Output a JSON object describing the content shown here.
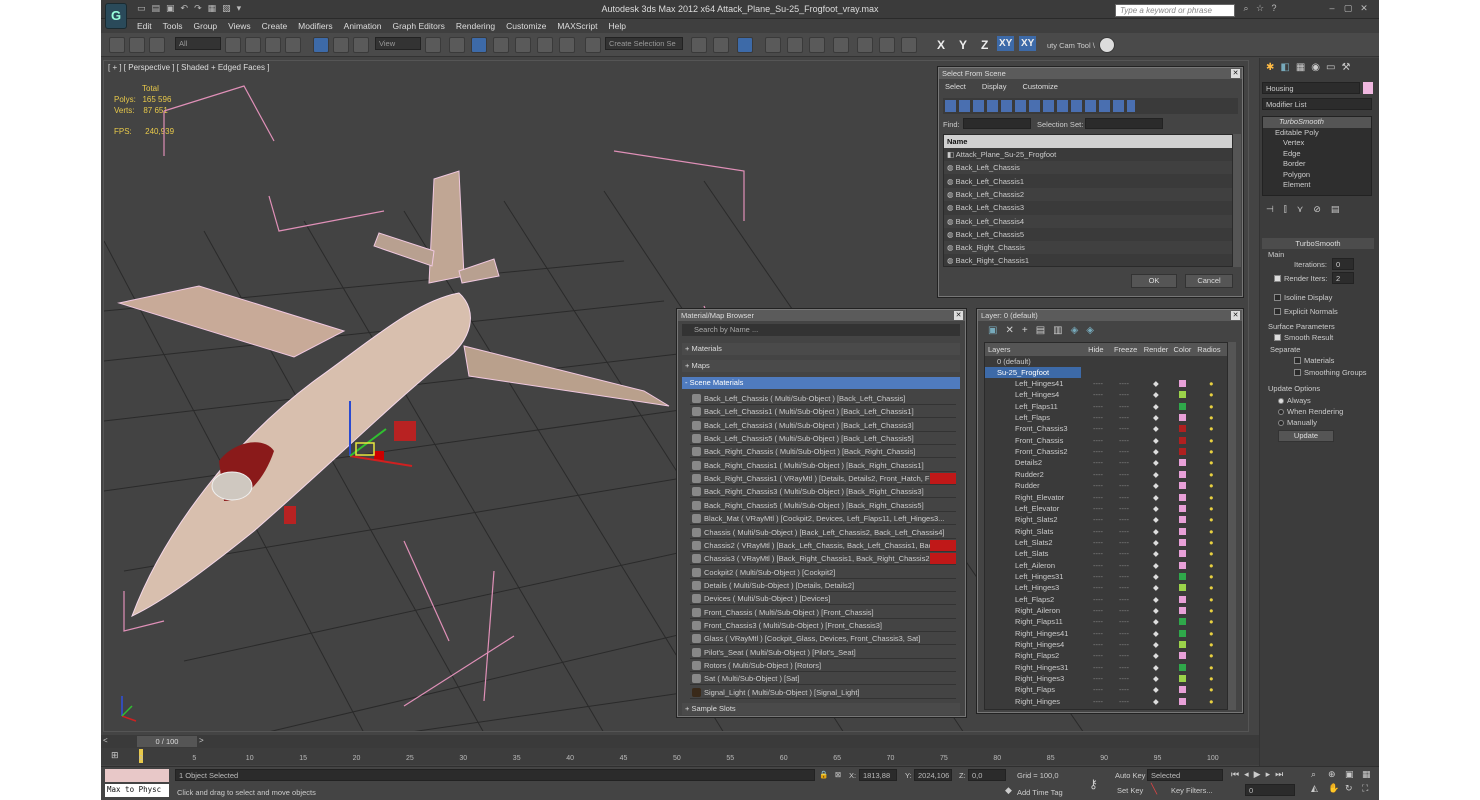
{
  "app": {
    "title": "Autodesk 3ds Max  2012 x64      Attack_Plane_Su-25_Frogfoot_vray.max",
    "search_placeholder": "Type a keyword or phrase"
  },
  "menu": [
    "Edit",
    "Tools",
    "Group",
    "Views",
    "Create",
    "Modifiers",
    "Animation",
    "Graph Editors",
    "Rendering",
    "Customize",
    "MAXScript",
    "Help"
  ],
  "toolbar": {
    "filter": "All",
    "refcoord": "View",
    "selection_set": "Create Selection Se",
    "axis_x": "X",
    "axis_y": "Y",
    "axis_z": "Z",
    "axis_xy": "XY",
    "axis_xy2": "XY",
    "cam_tool": "uty Cam Tool \\"
  },
  "viewport": {
    "label": "[ + ] [ Perspective ] [ Shaded + Edged Faces ]",
    "stats_header": "Total",
    "polys_label": "Polys:",
    "polys_value": "165 596",
    "verts_label": "Verts:",
    "verts_value": "87 651",
    "fps_label": "FPS:",
    "fps_value": "240,939"
  },
  "select_from_scene": {
    "title": "Select From Scene",
    "tabs": [
      "Select",
      "Display",
      "Customize"
    ],
    "find_label": "Find:",
    "selset_label": "Selection Set:",
    "col_name": "Name",
    "items": [
      "Attack_Plane_Su-25_Frogfoot",
      "Back_Left_Chassis",
      "Back_Left_Chassis1",
      "Back_Left_Chassis2",
      "Back_Left_Chassis3",
      "Back_Left_Chassis4",
      "Back_Left_Chassis5",
      "Back_Right_Chassis",
      "Back_Right_Chassis1"
    ],
    "ok": "OK",
    "cancel": "Cancel"
  },
  "material_browser": {
    "title": "Material/Map Browser",
    "search_placeholder": "Search by Name ...",
    "sec_materials": "+ Materials",
    "sec_maps": "+ Maps",
    "sec_scene": "- Scene Materials",
    "sec_samples": "+ Sample Slots",
    "items": [
      "Back_Left_Chassis  ( Multi/Sub-Object ) [Back_Left_Chassis]",
      "Back_Left_Chassis1  ( Multi/Sub-Object ) [Back_Left_Chassis1]",
      "Back_Left_Chassis3  ( Multi/Sub-Object ) [Back_Left_Chassis3]",
      "Back_Left_Chassis5  ( Multi/Sub-Object ) [Back_Left_Chassis5]",
      "Back_Right_Chassis  ( Multi/Sub-Object ) [Back_Right_Chassis]",
      "Back_Right_Chassis1  ( Multi/Sub-Object ) [Back_Right_Chassis1]",
      "Back_Right_Chassis1  ( VRayMtl ) [Details, Details2, Front_Hatch, Front...",
      "Back_Right_Chassis3  ( Multi/Sub-Object ) [Back_Right_Chassis3]",
      "Back_Right_Chassis5  ( Multi/Sub-Object ) [Back_Right_Chassis5]",
      "Black_Mat  ( VRayMtl ) [Cockpit2, Devices, Left_Flaps11, Left_Hinges3...",
      "Chassis  ( Multi/Sub-Object ) [Back_Left_Chassis2, Back_Left_Chassis4]",
      "Chassis2  ( VRayMtl ) [Back_Left_Chassis, Back_Left_Chassis1, Back_L...",
      "Chassis3  ( VRayMtl ) [Back_Right_Chassis1, Back_Right_Chassis2, Bac...",
      "Cockpit2  ( Multi/Sub-Object ) [Cockpit2]",
      "Details  ( Multi/Sub-Object ) [Details, Details2]",
      "Devices  ( Multi/Sub-Object ) [Devices]",
      "Front_Chassis  ( Multi/Sub-Object ) [Front_Chassis]",
      "Front_Chassis3  ( Multi/Sub-Object ) [Front_Chassis3]",
      "Glass  ( VRayMtl ) [Cockpit_Glass, Devices, Front_Chassis3, Sat]",
      "Pilot's_Seat  ( Multi/Sub-Object ) [Pilot's_Seat]",
      "Rotors  ( Multi/Sub-Object ) [Rotors]",
      "Sat  ( Multi/Sub-Object ) [Sat]",
      "Signal_Light  ( Multi/Sub-Object ) [Signal_Light]"
    ]
  },
  "layer_manager": {
    "title": "Layer: 0 (default)",
    "cols": [
      "Layers",
      "Hide",
      "Freeze",
      "Render",
      "Color",
      "Radios"
    ],
    "layer_default": "0 (default)",
    "layer_main": "Su-25_Frogfoot",
    "items": [
      "Left_Hinges41",
      "Left_Hinges4",
      "Left_Flaps11",
      "Left_Flaps",
      "Front_Chassis3",
      "Front_Chassis",
      "Front_Chassis2",
      "Details2",
      "Rudder2",
      "Rudder",
      "Right_Elevator",
      "Left_Elevator",
      "Right_Slats2",
      "Right_Slats",
      "Left_Slats2",
      "Left_Slats",
      "Left_Aileron",
      "Left_Hinges31",
      "Left_Hinges3",
      "Left_Flaps2",
      "Right_Aileron",
      "Right_Flaps11",
      "Right_Hinges41",
      "Right_Hinges4",
      "Right_Flaps2",
      "Right_Hinges31",
      "Right_Hinges3",
      "Right_Flaps",
      "Right_Hinges"
    ],
    "colors": [
      "#e8a0d8",
      "#9bd34a",
      "#2fa84a",
      "#e8a0d8",
      "#b02020",
      "#b02020",
      "#b02020",
      "#e8a0d8",
      "#e8a0d8",
      "#e8a0d8",
      "#e8a0d8",
      "#e8a0d8",
      "#e8a0d8",
      "#e8a0d8",
      "#e8a0d8",
      "#e8a0d8",
      "#e8a0d8",
      "#2fa84a",
      "#9bd34a",
      "#e8a0d8",
      "#e8a0d8",
      "#2fa84a",
      "#2fa84a",
      "#9bd34a",
      "#e8a0d8",
      "#2fa84a",
      "#9bd34a",
      "#e8a0d8",
      "#e8a0d8"
    ]
  },
  "command_panel": {
    "object_name": "Housing",
    "modifier_list": "Modifier List",
    "stack": [
      "TurboSmooth",
      "Editable Poly",
      "Vertex",
      "Edge",
      "Border",
      "Polygon",
      "Element"
    ],
    "rollout_title": "TurboSmooth",
    "main": "Main",
    "iterations_label": "Iterations:",
    "iterations_value": "0",
    "render_iters_label": "Render Iters:",
    "render_iters_value": "2",
    "isoline": "Isoline Display",
    "explicit": "Explicit Normals",
    "surface_params": "Surface Parameters",
    "smooth_result": "Smooth Result",
    "separate": "Separate",
    "materials": "Materials",
    "smoothing_groups": "Smoothing Groups",
    "update_options": "Update Options",
    "always": "Always",
    "when_rendering": "When Rendering",
    "manually": "Manually",
    "update": "Update"
  },
  "timeline": {
    "frame": "0 / 100",
    "ticks": [
      "0",
      "5",
      "10",
      "15",
      "20",
      "25",
      "30",
      "35",
      "40",
      "45",
      "50",
      "55",
      "60",
      "65",
      "70",
      "75",
      "80",
      "85",
      "90",
      "95",
      "100"
    ]
  },
  "status": {
    "maxscript": "Max to Physc",
    "selected": "1 Object Selected",
    "prompt": "Click and drag to select and move objects",
    "x_label": "X:",
    "x_value": "1813,88",
    "y_label": "Y:",
    "y_value": "2024,106",
    "z_label": "Z:",
    "z_value": "0,0",
    "grid": "Grid = 100,0",
    "add_time_tag": "Add Time Tag",
    "auto_key": "Auto Key",
    "set_key": "Set Key",
    "selected_dd": "Selected",
    "key_filters": "Key Filters...",
    "frame_value": "0"
  }
}
